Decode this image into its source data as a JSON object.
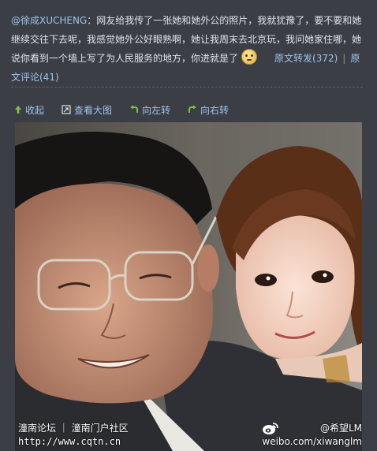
{
  "post": {
    "author": "@徐成XUCHENG",
    "text": "：网友给我传了一张她和她外公的照片，我就犹豫了，要不要和她继续交往下去呢，我感觉她外公好眼熟啊，她让我周末去北京玩，我问她家住哪，她说你看到一个墙上写了为人民服务的地方，你进就是了",
    "emoji_icon": "thinking-face-emoji",
    "repost_label": "原文转发(372)",
    "separator": "|",
    "comment_label": "原文评论(41)"
  },
  "toolbar": {
    "collapse_label": "收起",
    "view_large_label": "查看大图",
    "rotate_left_label": "向左转",
    "rotate_right_label": "向右转"
  },
  "watermark": {
    "left_site": "潼南论坛 ｜ 潼南门户社区",
    "left_url": "http://www.cqtn.cn",
    "right_handle": "@希望LM",
    "right_url": "weibo.com/xiwanglm"
  },
  "colors": {
    "background": "#3b3e44",
    "link": "#9cc4ec",
    "text": "#dfe3e8"
  }
}
